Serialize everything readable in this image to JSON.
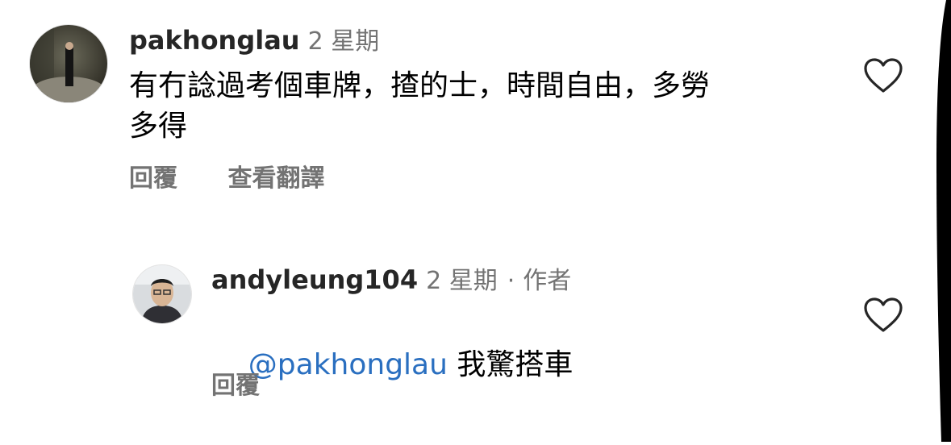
{
  "comments": [
    {
      "username": "pakhonglau",
      "time": "2 星期",
      "text_line1": "有冇諗過考個車牌，揸的士，時間自由，多勞",
      "text_line2": "多得",
      "actions": {
        "reply": "回覆",
        "translate": "查看翻譯"
      },
      "icon": "heart-outline-icon"
    }
  ],
  "reply": {
    "username": "andyleung104",
    "time": "2 星期",
    "separator": "·",
    "role": "作者",
    "mention": "@pakhonglau",
    "text": " 我驚搭車",
    "actions": {
      "reply": "回覆"
    },
    "icon": "heart-outline-icon"
  },
  "colors": {
    "mention": "#2a6fc0",
    "muted": "#737373"
  }
}
